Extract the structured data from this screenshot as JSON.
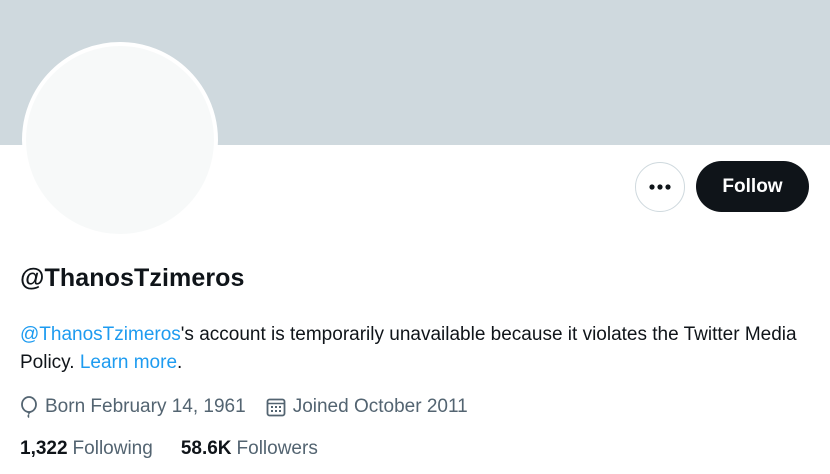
{
  "profile": {
    "handle": "@ThanosTzimeros",
    "notice": {
      "mention": "@ThanosTzimeros",
      "text": "'s account is temporarily unavailable because it violates the Twitter Media Policy. ",
      "learn_more": "Learn more",
      "end": "."
    },
    "born": "Born February 14, 1961",
    "joined": "Joined October 2011",
    "following_count": "1,322",
    "following_label": "Following",
    "followers_count": "58.6K",
    "followers_label": "Followers"
  },
  "actions": {
    "follow_label": "Follow",
    "more_icon": "more-horizontal-icon"
  },
  "colors": {
    "banner": "#cfd9de",
    "link": "#1d9bf0",
    "follow_bg": "#0f1419",
    "muted_text": "#536471"
  }
}
